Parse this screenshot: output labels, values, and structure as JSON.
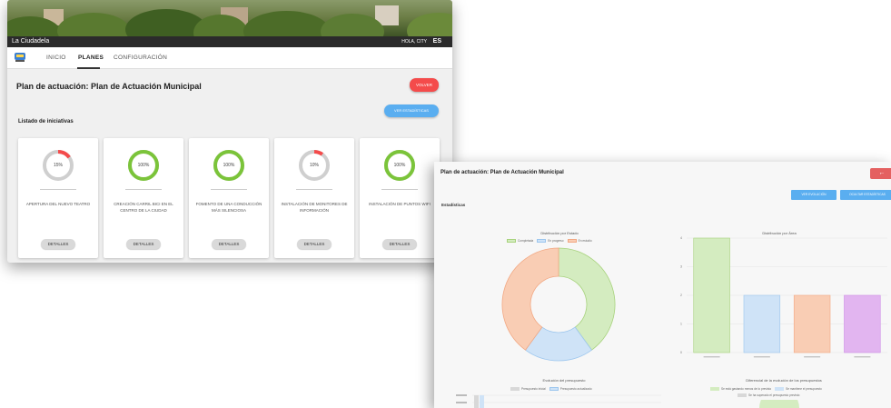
{
  "back_window": {
    "app_title": "La Ciudadela",
    "user_greeting": "HOLA, CITY",
    "language": "ES",
    "nav": [
      {
        "label": "INICIO"
      },
      {
        "label": "PLANES"
      },
      {
        "label": "CONFIGURACIÓN"
      }
    ],
    "page_title": "Plan de actuación: Plan de Actuación Municipal",
    "volver_label": "VOLVER",
    "stats_button_label": "VER ESTADÍSTICAS",
    "list_heading": "Listado de iniciativas",
    "initiatives": [
      {
        "percent_label": "15%",
        "progress": 0.15,
        "name": "APERTURA DEL NUEVO TEATRO",
        "button": "DETALLES"
      },
      {
        "percent_label": "100%",
        "progress": 1.0,
        "name": "CREACIÓN CARRIL BICI EN EL CENTRO DE LA CIUDAD",
        "button": "DETALLES"
      },
      {
        "percent_label": "100%",
        "progress": 1.0,
        "name": "FOMENTO DE UNA CONDUCCIÓN MÁS SILENCIOSA",
        "button": "DETALLES"
      },
      {
        "percent_label": "10%",
        "progress": 0.1,
        "name": "INSTALACIÓN DE MONITORES DE INFORMACIÓN",
        "button": "DETALLES"
      },
      {
        "percent_label": "100%",
        "progress": 1.0,
        "name": "INSTALACIÓN DE PUNTOS WIFI",
        "button": "DETALLES"
      }
    ]
  },
  "front_window": {
    "page_title": "Plan de actuación: Plan de Actuación Municipal",
    "back_icon": "arrow-left-icon",
    "evolution_button": "VER EVOLUCIÓN",
    "hide_stats_button": "OCULTAR ESTADÍSTICAS",
    "section_title": "Estadísticas",
    "donut_title": "Distribución por Estado",
    "donut_legend": [
      "Completada",
      "En progreso",
      "En estudio"
    ],
    "bar_title": "Distribución por Área",
    "budget_title": "Evolución del presupuesto",
    "budget_legend": [
      "Presupuesto inicial",
      "Presupuesto actualizado"
    ],
    "diff_title": "Diferencial de la evolución de los presupuestos",
    "diff_legend": [
      "Se está gastando menos de lo previsto",
      "Se mantiene el presupuesto",
      "Se ha superado el presupuesto previsto"
    ]
  },
  "colors": {
    "green": "#7bc43a",
    "red": "#f44b4b",
    "blue_button": "#5aaef0",
    "donut_green": "#d4ecc0",
    "donut_blue": "#cfe3f7",
    "donut_orange": "#f9cdb4",
    "bar_purple": "#e2b5f0"
  },
  "chart_data": [
    {
      "type": "pie",
      "title": "Distribución por Estado",
      "categories": [
        "Completada",
        "En progreso",
        "En estudio"
      ],
      "values": [
        2,
        1,
        2
      ]
    },
    {
      "type": "bar",
      "title": "Distribución por Área",
      "categories": [
        "",
        "",
        "",
        ""
      ],
      "values": [
        4,
        2,
        2,
        2
      ],
      "ylim": [
        0,
        4
      ],
      "yticks": [
        "0",
        "1",
        "2",
        "3",
        "4"
      ]
    }
  ]
}
